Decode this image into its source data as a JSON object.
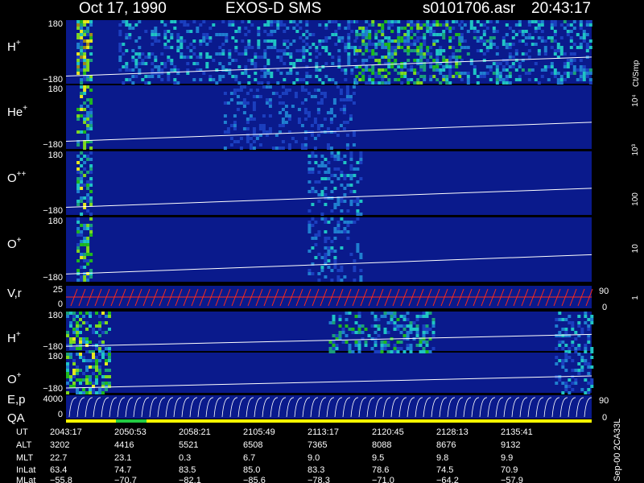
{
  "header": {
    "date": "Oct 17, 1990",
    "instrument": "EXOS-D SMS",
    "file": "s0101706.asr",
    "time": "20:43:17"
  },
  "colors": {
    "background": "#000000",
    "panel_fill": "#0a1a8c",
    "trace_white": "#ffffff",
    "vr_trace": "#ff2a1a",
    "qa_bar": "#ffff00",
    "qa_green": "#22cc44"
  },
  "colorbar": {
    "title": "Ct/Smp",
    "labels": [
      "1",
      "10",
      "100",
      "10³",
      "10⁴"
    ],
    "levels": [
      1,
      10,
      100,
      1000,
      10000
    ],
    "colors": [
      "#0a1a8c",
      "#1b3fbf",
      "#1f7fd0",
      "#1fc4c4",
      "#1aa07a",
      "#1fb81f",
      "#7fd81f",
      "#e8e81f",
      "#a08a1a",
      "#7a7a10",
      "#ff1a1a",
      "#c81414",
      "#a01010",
      "#7a0a0a",
      "#ffffff"
    ]
  },
  "panels": [
    {
      "id": "h-plus-top",
      "label": "H",
      "sup": "+",
      "y_top": "180",
      "y_bot": "−180"
    },
    {
      "id": "he-plus",
      "label": "He",
      "sup": "+",
      "y_top": "180",
      "y_bot": "−180"
    },
    {
      "id": "o-plus-plus",
      "label": "O",
      "sup": "++",
      "y_top": "180",
      "y_bot": "−180"
    },
    {
      "id": "o-plus-top",
      "label": "O",
      "sup": "+",
      "y_top": "180",
      "y_bot": "−180"
    },
    {
      "id": "v-r",
      "label": "V,r",
      "sup": "",
      "y_top": "25",
      "y_bot": "0",
      "right_top": "90",
      "right_bot": "0"
    },
    {
      "id": "h-plus-bottom",
      "label": "H",
      "sup": "+",
      "y_top": "180",
      "y_bot": "−180"
    },
    {
      "id": "o-plus-bottom",
      "label": "O",
      "sup": "+",
      "y_top": "180",
      "y_bot": "−180"
    },
    {
      "id": "e-p",
      "label": "E,p",
      "sup": "",
      "y_top": "4000",
      "y_bot": "0",
      "right_top": "90",
      "right_bot": "0"
    }
  ],
  "qa_label": "QA",
  "side_note": "Sep-00  2CA33L",
  "table": {
    "row_labels": [
      "UT",
      "ALT",
      "MLT",
      "InLat",
      "MLat"
    ],
    "rows": [
      [
        "2043:17",
        "2050:53",
        "2058:21",
        "2105:49",
        "2113:17",
        "2120:45",
        "2128:13",
        "2135:41"
      ],
      [
        "3202",
        "4416",
        "5521",
        "6508",
        "7365",
        "8088",
        "8676",
        "9132"
      ],
      [
        "22.7",
        "23.1",
        "0.3",
        "6.7",
        "9.0",
        "9.5",
        "9.8",
        "9.9"
      ],
      [
        "63.4",
        "74.7",
        "83.5",
        "85.0",
        "83.3",
        "78.6",
        "74.5",
        "70.9"
      ],
      [
        "−55.8",
        "−70.7",
        "−82.1",
        "−85.6",
        "−78.3",
        "−71.0",
        "−64.2",
        "−57.9"
      ]
    ]
  },
  "chart_data": {
    "type": "heatmap",
    "title": "Oct 17, 1990   EXOS-D SMS",
    "x_ticks_ut": [
      "2043:17",
      "2050:53",
      "2058:21",
      "2105:49",
      "2113:17",
      "2120:45",
      "2128:13",
      "2135:41"
    ],
    "ylim_pitch": [
      -180,
      180
    ],
    "colorbar_range": [
      1,
      10000
    ],
    "colorbar_scale": "log",
    "series": [
      {
        "name": "H+",
        "bursts": [
          [
            0.02,
            0.05,
            1.0
          ],
          [
            0.1,
            0.55,
            0.35
          ],
          [
            0.55,
            0.75,
            0.7
          ],
          [
            0.75,
            1.0,
            0.4
          ]
        ]
      },
      {
        "name": "He+",
        "bursts": [
          [
            0.02,
            0.05,
            0.9
          ],
          [
            0.3,
            0.55,
            0.2
          ]
        ]
      },
      {
        "name": "O++",
        "bursts": [
          [
            0.02,
            0.05,
            0.8
          ],
          [
            0.46,
            0.56,
            0.3
          ]
        ]
      },
      {
        "name": "O+",
        "bursts": [
          [
            0.02,
            0.05,
            0.8
          ],
          [
            0.46,
            0.56,
            0.3
          ]
        ]
      },
      {
        "name": "H+",
        "bursts": [
          [
            0.0,
            0.08,
            0.8
          ],
          [
            0.5,
            0.7,
            0.55
          ],
          [
            0.93,
            1.0,
            0.35
          ]
        ]
      },
      {
        "name": "O+",
        "bursts": [
          [
            0.0,
            0.08,
            0.8
          ],
          [
            0.93,
            1.0,
            0.35
          ]
        ]
      }
    ]
  }
}
